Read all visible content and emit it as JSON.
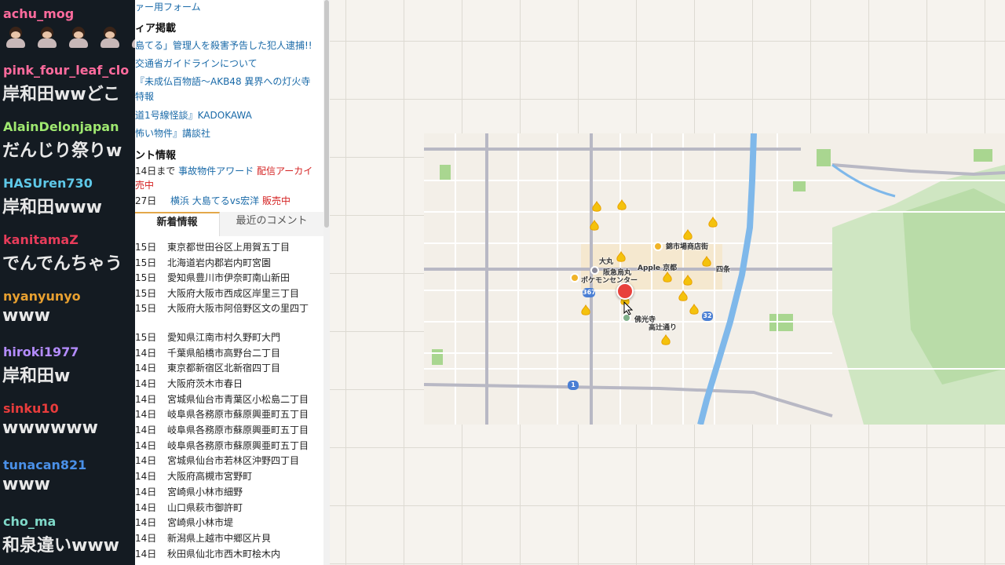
{
  "chat": {
    "messages": [
      {
        "user": "achu_mog",
        "color": "#ff6b9d",
        "text": "",
        "emotes": 5
      },
      {
        "user": "pink_four_leaf_clo",
        "color": "#ff6b9d",
        "text": "岸和田wwどこ"
      },
      {
        "user": "AlainDelonjapan",
        "color": "#9fe870",
        "text": "だんじり祭りw"
      },
      {
        "user": "HASUren730",
        "color": "#5ec8e8",
        "text": "岸和田www"
      },
      {
        "user": "kanitamaZ",
        "color": "#e83c5a",
        "text": "でんでんちゃう"
      },
      {
        "user": "nyanyunyo",
        "color": "#e8a030",
        "text": "www"
      },
      {
        "user": "hiroki1977",
        "color": "#b48cff",
        "text": "岸和田w"
      },
      {
        "user": "sinku10",
        "color": "#e83c3c",
        "text": "wwwwww"
      },
      {
        "user": "tunacan821",
        "color": "#4a90e8",
        "text": "www"
      },
      {
        "user": "cho_ma",
        "color": "#7fd8c8",
        "text": "和泉違いwww"
      }
    ]
  },
  "page": {
    "top_link": "ァー用フォーム",
    "media_heading": "ィア掲載",
    "media_links": [
      "島てる」管理人を殺害予告した犯人逮捕!!",
      "交通省ガイドラインについて",
      "『未成仏百物語～AKB48 異界への灯火寺",
      "特報",
      "道1号線怪談』KADOKAWA",
      "怖い物件』講談社"
    ],
    "event_heading": "ント情報",
    "events": [
      {
        "prefix": "14日まで",
        "link": "事故物件アワード",
        "status": "配信アーカイ",
        "extra": "売中"
      },
      {
        "prefix": "27日",
        "link": "横浜 大島てるvs宏洋",
        "status": "販売中"
      }
    ],
    "tabs": {
      "new": "新着情報",
      "comments": "最近のコメント"
    },
    "news": [
      {
        "date": "15日",
        "addr": "東京都世田谷区上用賀五丁目"
      },
      {
        "date": "15日",
        "addr": "北海道岩内郡岩内町宮園"
      },
      {
        "date": "15日",
        "addr": "愛知県豊川市伊奈町南山新田"
      },
      {
        "date": "15日",
        "addr": "大阪府大阪市西成区岸里三丁目"
      },
      {
        "date": "15日",
        "addr": "大阪府大阪市阿倍野区文の里四丁"
      },
      {
        "date": "15日",
        "addr": "愛知県江南市村久野町大門"
      },
      {
        "date": "14日",
        "addr": "千葉県船橋市高野台二丁目"
      },
      {
        "date": "14日",
        "addr": "東京都新宿区北新宿四丁目"
      },
      {
        "date": "14日",
        "addr": "大阪府茨木市春日"
      },
      {
        "date": "14日",
        "addr": "宮城県仙台市青葉区小松島二丁目"
      },
      {
        "date": "14日",
        "addr": "岐阜県各務原市蘇原興亜町五丁目"
      },
      {
        "date": "14日",
        "addr": "岐阜県各務原市蘇原興亜町五丁目"
      },
      {
        "date": "14日",
        "addr": "岐阜県各務原市蘇原興亜町五丁目"
      },
      {
        "date": "14日",
        "addr": "宮城県仙台市若林区沖野四丁目"
      },
      {
        "date": "14日",
        "addr": "大阪府高槻市宮野町"
      },
      {
        "date": "14日",
        "addr": "宮崎県小林市細野"
      },
      {
        "date": "14日",
        "addr": "山口県萩市御許町"
      },
      {
        "date": "14日",
        "addr": "宮崎県小林市堤"
      },
      {
        "date": "14日",
        "addr": "新潟県上越市中郷区片貝"
      },
      {
        "date": "14日",
        "addr": "秋田県仙北市西木町桧木内"
      }
    ]
  },
  "map": {
    "labels": {
      "nishiki": "錦市場商店街",
      "daimaru": "大丸",
      "hankyu": "阪急烏丸",
      "apple": "Apple 京都",
      "pokemon": "ポケモンセンター",
      "shijo": "四条",
      "bukkoji": "佛光寺",
      "takatsuji": "高辻通り",
      "route367": "367",
      "route32": "32",
      "route1": "1"
    },
    "colors": {
      "marker": "#f4c20d",
      "selected": "#e8413c",
      "river": "#7fb8ea",
      "park": "#9ed58c"
    }
  }
}
